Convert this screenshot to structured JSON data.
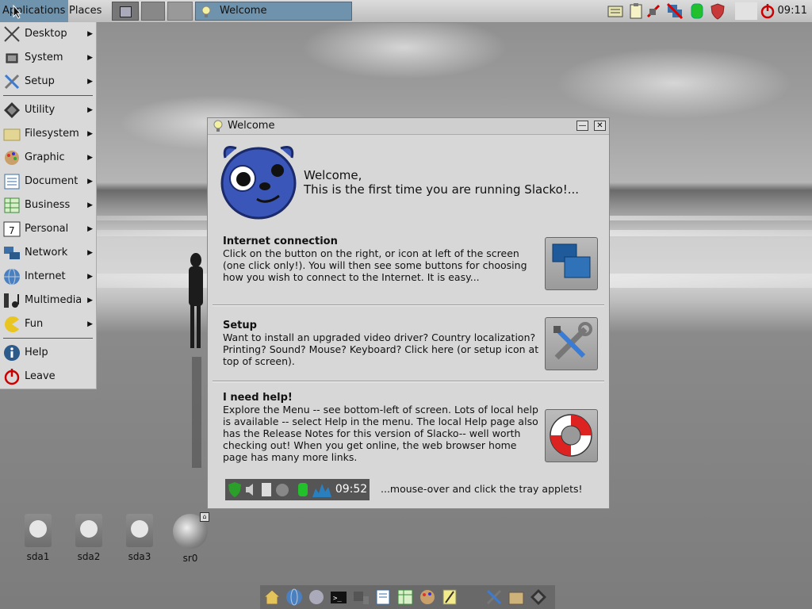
{
  "top_panel": {
    "applications_label": "Applications",
    "places_label": "Places",
    "taskbar_window_title": "Welcome",
    "clock": "09:11"
  },
  "app_menu": {
    "items": [
      {
        "label": "Desktop",
        "icon": "desktop-icon",
        "submenu": true
      },
      {
        "label": "System",
        "icon": "system-icon",
        "submenu": true
      },
      {
        "label": "Setup",
        "icon": "setup-tools-icon",
        "submenu": true
      },
      {
        "label": "Utility",
        "icon": "utility-icon",
        "submenu": true
      },
      {
        "label": "Filesystem",
        "icon": "folder-icon",
        "submenu": true
      },
      {
        "label": "Graphic",
        "icon": "palette-icon",
        "submenu": true
      },
      {
        "label": "Document",
        "icon": "document-icon",
        "submenu": true
      },
      {
        "label": "Business",
        "icon": "spreadsheet-icon",
        "submenu": true
      },
      {
        "label": "Personal",
        "icon": "calendar-icon",
        "submenu": true
      },
      {
        "label": "Network",
        "icon": "network-icon",
        "submenu": true
      },
      {
        "label": "Internet",
        "icon": "globe-icon",
        "submenu": true
      },
      {
        "label": "Multimedia",
        "icon": "multimedia-icon",
        "submenu": true
      },
      {
        "label": "Fun",
        "icon": "pacman-icon",
        "submenu": true
      },
      {
        "label": "Help",
        "icon": "help-icon",
        "submenu": false
      },
      {
        "label": "Leave",
        "icon": "power-icon",
        "submenu": false
      }
    ],
    "calendar_day": "7"
  },
  "welcome_window": {
    "title": "Welcome",
    "minimize_glyph": "—",
    "close_glyph": "✕",
    "heading_line1": "Welcome,",
    "heading_line2": "This is the first time you are running Slacko!...",
    "sections": [
      {
        "title": "Internet connection",
        "body": "Click on the button on the right, or icon at left of the screen (one click only!). You will then see some buttons for choosing how you wish to connect to the Internet. It is easy...",
        "button_icon": "network-connect-icon"
      },
      {
        "title": "Setup",
        "body": "Want to install an upgraded video driver? Country localization? Printing? Sound? Mouse? Keyboard? Click here (or setup icon at top of screen).",
        "button_icon": "setup-tools-icon"
      },
      {
        "title": "I need help!",
        "body": "Explore the Menu -- see bottom-left of screen. Lots of local help is available -- select Help in the menu. The local Help page also has the Release Notes for this version of Slacko-- well worth checking out! When you get online, the web browser home page has many more links.",
        "button_icon": "lifebuoy-icon"
      }
    ],
    "tray_preview_time": "09:52",
    "tray_hint": "...mouse-over and click the tray applets!"
  },
  "desktop_drives": [
    {
      "label": "sda1"
    },
    {
      "label": "sda2"
    },
    {
      "label": "sda3"
    },
    {
      "label": "sr0"
    }
  ],
  "colors": {
    "panel_accent": "#6f93ad",
    "window_bg": "#d7d7d7",
    "menu_bg": "#d9d9d9"
  }
}
